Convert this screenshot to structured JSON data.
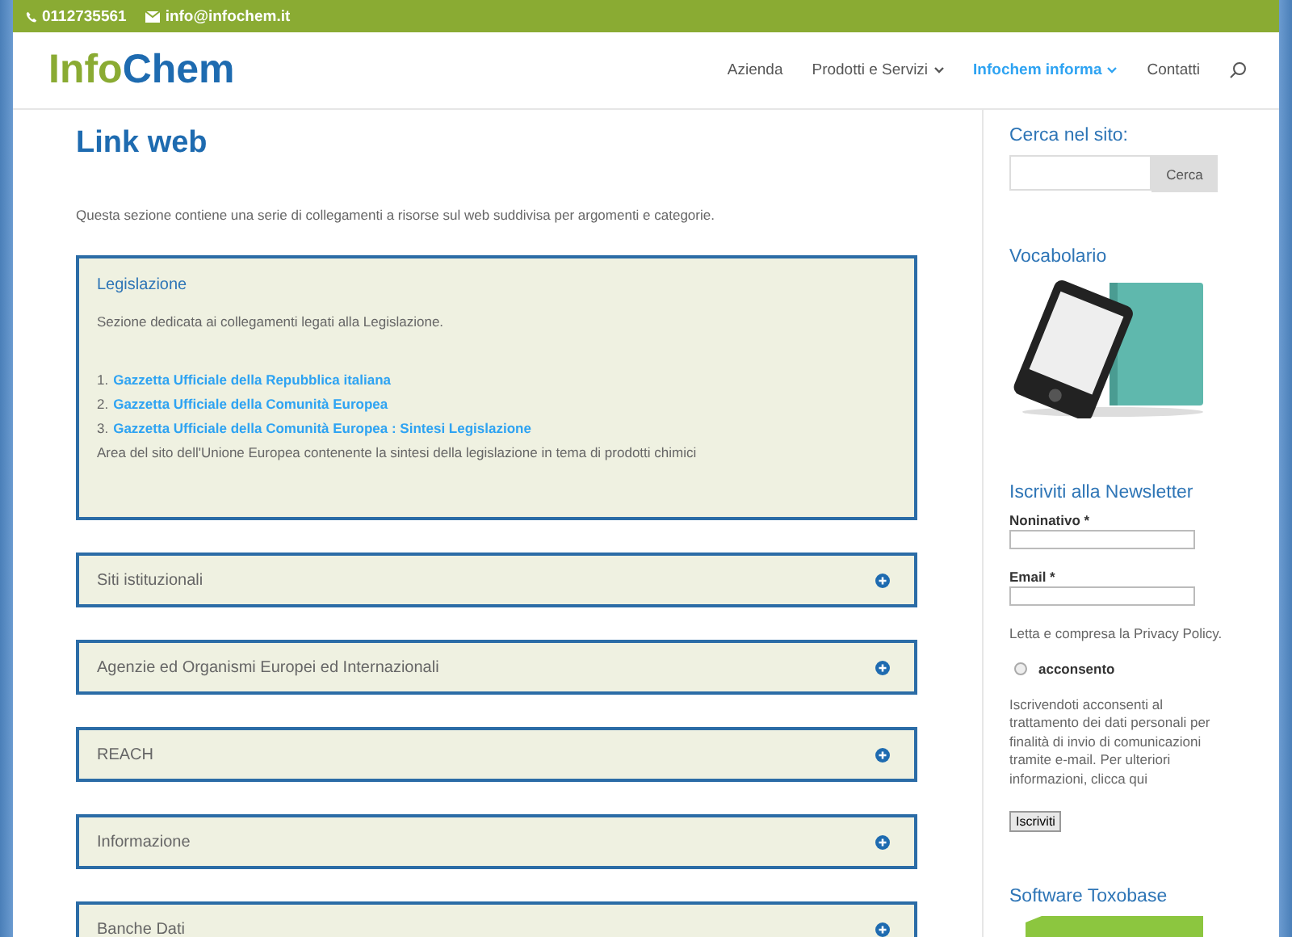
{
  "top_bar": {
    "phone": "0112735561",
    "email": "info@infochem.it"
  },
  "header": {
    "logo": {
      "part_1": "Info",
      "part_2": "Chem"
    },
    "nav": [
      {
        "label": "Azienda",
        "has_menu": false,
        "selected": false
      },
      {
        "label": "Prodotti e Servizi",
        "has_menu": true,
        "selected": false
      },
      {
        "label": "Infochem informa",
        "has_menu": true,
        "selected": true
      },
      {
        "label": "Contatti",
        "has_menu": false,
        "selected": false
      }
    ]
  },
  "main": {
    "title": "Link web",
    "intro": "Questa sezione contiene una serie di collegamenti a risorse sul web suddivisa per argomenti e categorie.",
    "sections": [
      {
        "title": "Legislazione",
        "expanded": true,
        "description": "Sezione dedicata ai collegamenti legati alla Legislazione.",
        "links": [
          {
            "number": "1.",
            "label": "Gazzetta Ufficiale della Repubblica italiana"
          },
          {
            "number": "2.",
            "label": "Gazzetta Ufficiale della Comunità Europea"
          },
          {
            "number": "3.",
            "label": "Gazzetta Ufficiale della Comunità Europea : Sintesi Legislazione"
          }
        ],
        "note": "Area del sito dell'Unione Europea contenente la sintesi della legislazione in tema di prodotti chimici"
      },
      {
        "title": "Siti istituzionali",
        "expanded": false
      },
      {
        "title": "Agenzie ed Organismi Europei ed Internazionali",
        "expanded": false
      },
      {
        "title": "REACH",
        "expanded": false
      },
      {
        "title": "Informazione",
        "expanded": false
      },
      {
        "title": "Banche Dati",
        "expanded": false
      }
    ]
  },
  "sidebar": {
    "search": {
      "title": "Cerca nel sito:",
      "button": "Cerca"
    },
    "vocabolario": {
      "title": "Vocabolario"
    },
    "newsletter": {
      "title": "Iscriviti alla Newsletter",
      "name_label": "Noninativo *",
      "email_label": "Email *",
      "privacy": "Letta e compresa la Privacy Policy.",
      "consent": {
        "label": "acconsento",
        "checked": false
      },
      "info": "Iscrivendoti acconsenti al trattamento dei dati personali per finalità di invio di comunicazioni tramite e-mail. Per ulteriori informazioni, clicca qui",
      "button": "Iscriviti"
    },
    "software": {
      "title": "Software Toxobase"
    }
  }
}
